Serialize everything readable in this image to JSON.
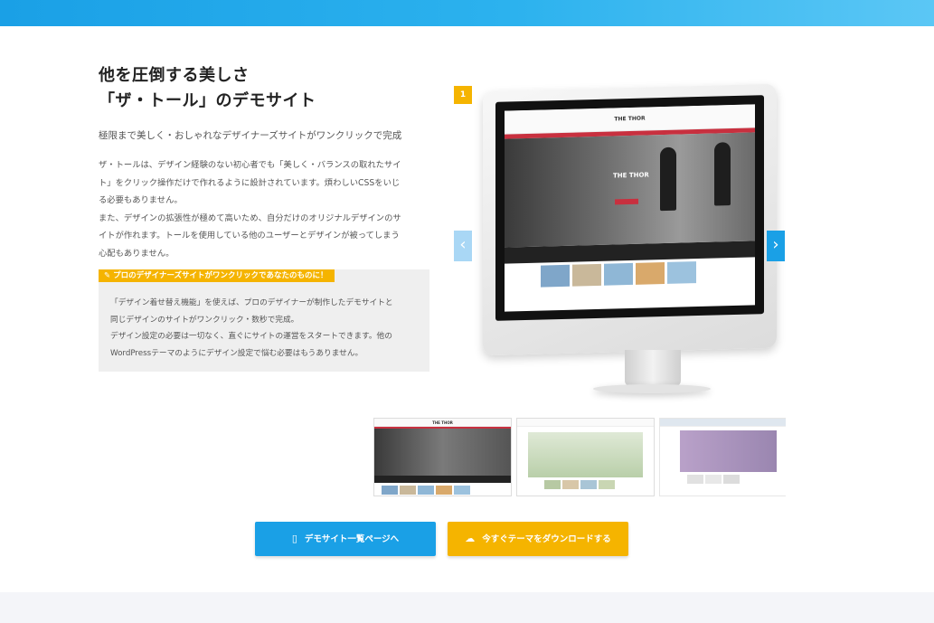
{
  "header": {
    "title_line1": "他を圧倒する美しさ",
    "title_line2": "「ザ・トール」のデモサイト",
    "subtitle": "極限まで美しく・おしゃれなデザイナーズサイトがワンクリックで完成",
    "paragraph1_line1": "ザ・トールは、デザイン経験のない初心者でも「美しく・バランスの取れたサイ",
    "paragraph1_line2": "ト」をクリック操作だけで作れるように設計されています。煩わしいCSSをいじ",
    "paragraph1_line3": "る必要もありません。",
    "paragraph2_line1": "また、デザインの拡張性が極めて高いため、自分だけのオリジナルデザインのサ",
    "paragraph2_line2": "イトが作れます。トールを使用している他のユーザーとデザインが被ってしまう",
    "paragraph2_line3": "心配もありません。"
  },
  "highlight": {
    "tag": "プロのデザイナーズサイトがワンクリックであなたのものに！",
    "line1": "「デザイン着せ替え機能」を使えば、プロのデザイナーが制作したデモサイトと",
    "line2": "同じデザインのサイトがワンクリック・数秒で完成。",
    "line3": "デザイン設定の必要は一切なく、直ぐにサイトの運営をスタートできます。他の",
    "line4": "WordPressテーマのようにデザイン設定で悩む必要はもうありません。"
  },
  "slider": {
    "current_slide": "1",
    "prev_symbol": "‹",
    "next_symbol": "›",
    "screen_logo": "THE THOR",
    "screen_hero_title": "THE THOR"
  },
  "thumbnails": [
    {
      "label": "THE THOR"
    },
    {
      "label": ""
    },
    {
      "label": ""
    }
  ],
  "buttons": {
    "demo_label": "デモサイト一覧ページへ",
    "demo_icon": "smartphone-icon",
    "download_label": "今すぐテーマをダウンロードする",
    "download_icon": "cloud-download-icon"
  },
  "colors": {
    "accent_blue": "#1aa0e6",
    "accent_yellow": "#f5b400",
    "accent_red": "#c8303f"
  }
}
